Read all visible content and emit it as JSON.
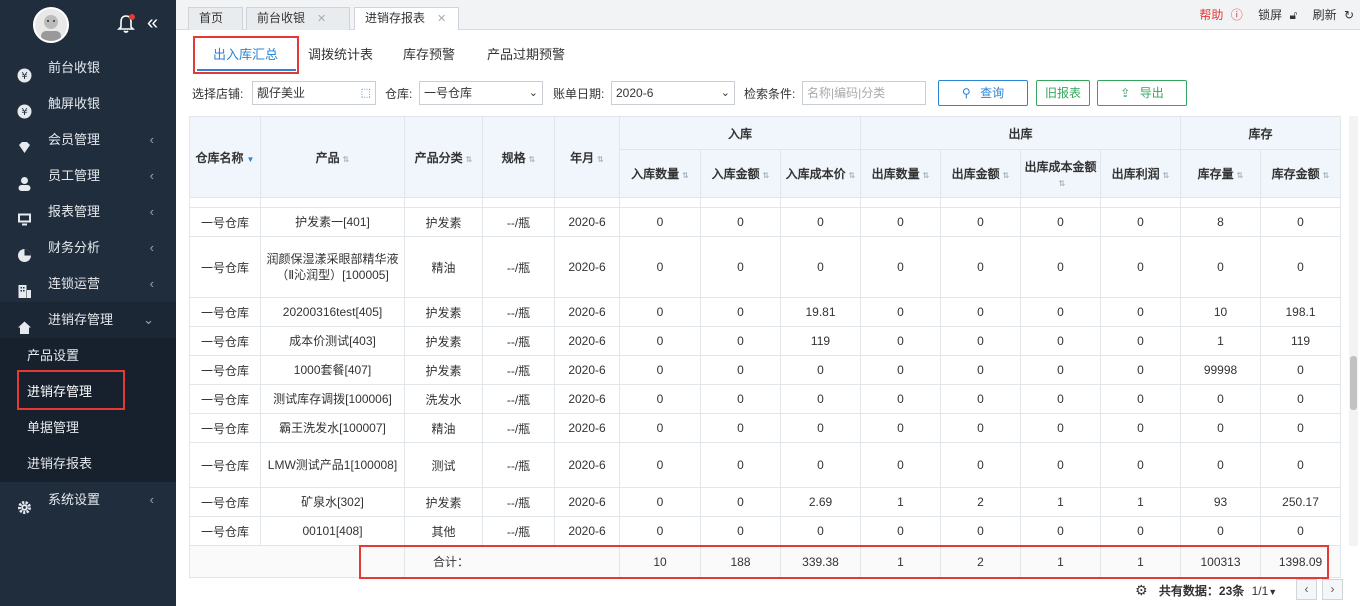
{
  "sidebar": {
    "menu": [
      {
        "label": "前台收银",
        "icon": "cash-icon",
        "arrow": ""
      },
      {
        "label": "触屏收银",
        "icon": "cash-icon",
        "arrow": ""
      },
      {
        "label": "会员管理",
        "icon": "diamond-icon",
        "arrow": "‹"
      },
      {
        "label": "员工管理",
        "icon": "user-icon",
        "arrow": "‹"
      },
      {
        "label": "报表管理",
        "icon": "monitor-icon",
        "arrow": "‹"
      },
      {
        "label": "财务分析",
        "icon": "pie-chart-icon",
        "arrow": "‹"
      },
      {
        "label": "连锁运营",
        "icon": "building-icon",
        "arrow": "‹"
      },
      {
        "label": "进销存管理",
        "icon": "home-icon",
        "arrow": "⌄"
      }
    ],
    "submenu": [
      "产品设置",
      "进销存管理",
      "单据管理",
      "进销存报表"
    ],
    "settings": {
      "label": "系统设置",
      "icon": "gear-icon",
      "arrow": "‹"
    }
  },
  "topbar": {
    "tabs": [
      {
        "label": "首页",
        "closable": false
      },
      {
        "label": "前台收银",
        "closable": true
      },
      {
        "label": "进销存报表",
        "closable": true
      }
    ],
    "help": "帮助",
    "lock": "锁屏",
    "refresh": "刷新"
  },
  "subtabs": [
    "出入库汇总",
    "调拨统计表",
    "库存预警",
    "产品过期预警"
  ],
  "filters": {
    "store_label": "选择店铺:",
    "store_value": "靓仔美业",
    "warehouse_label": "仓库:",
    "warehouse_value": "一号仓库",
    "date_label": "账单日期:",
    "date_value": "2020-6",
    "search_label": "检索条件:",
    "search_placeholder": "名称|编码|分类",
    "query_btn": "查询",
    "old_report_btn": "旧报表",
    "export_btn": "导出"
  },
  "table": {
    "group_headers": {
      "in": "入库",
      "out": "出库",
      "stock": "库存"
    },
    "headers": {
      "warehouse": "仓库名称",
      "product": "产品",
      "category": "产品分类",
      "spec": "规格",
      "month": "年月",
      "in_qty": "入库数量",
      "in_amount": "入库金额",
      "in_cost": "入库成本价",
      "out_qty": "出库数量",
      "out_amount": "出库金额",
      "out_cost": "出库成本金额",
      "out_profit": "出库利润",
      "stock_qty": "库存量",
      "stock_amount": "库存金额"
    },
    "rows": [
      [
        "一号仓库",
        "护发素一[401]",
        "护发素",
        "--/瓶",
        "2020-6",
        "0",
        "0",
        "0",
        "0",
        "0",
        "0",
        "0",
        "8",
        "0"
      ],
      [
        "一号仓库",
        "润颜保湿漾采眼部精华液（Ⅱ沁润型）[100005]",
        "精油",
        "--/瓶",
        "2020-6",
        "0",
        "0",
        "0",
        "0",
        "0",
        "0",
        "0",
        "0",
        "0"
      ],
      [
        "一号仓库",
        "20200316test[405]",
        "护发素",
        "--/瓶",
        "2020-6",
        "0",
        "0",
        "19.81",
        "0",
        "0",
        "0",
        "0",
        "10",
        "198.1"
      ],
      [
        "一号仓库",
        "成本价测试[403]",
        "护发素",
        "--/瓶",
        "2020-6",
        "0",
        "0",
        "119",
        "0",
        "0",
        "0",
        "0",
        "1",
        "119"
      ],
      [
        "一号仓库",
        "1000套餐[407]",
        "护发素",
        "--/瓶",
        "2020-6",
        "0",
        "0",
        "0",
        "0",
        "0",
        "0",
        "0",
        "99998",
        "0"
      ],
      [
        "一号仓库",
        "测试库存调拨[100006]",
        "洗发水",
        "--/瓶",
        "2020-6",
        "0",
        "0",
        "0",
        "0",
        "0",
        "0",
        "0",
        "0",
        "0"
      ],
      [
        "一号仓库",
        "霸王洗发水[100007]",
        "精油",
        "--/瓶",
        "2020-6",
        "0",
        "0",
        "0",
        "0",
        "0",
        "0",
        "0",
        "0",
        "0"
      ],
      [
        "一号仓库",
        "LMW测试产品1[100008]",
        "测试",
        "--/瓶",
        "2020-6",
        "0",
        "0",
        "0",
        "0",
        "0",
        "0",
        "0",
        "0",
        "0"
      ],
      [
        "一号仓库",
        "矿泉水[302]",
        "护发素",
        "--/瓶",
        "2020-6",
        "0",
        "0",
        "2.69",
        "1",
        "2",
        "1",
        "1",
        "93",
        "250.17"
      ],
      [
        "一号仓库",
        "00101[408]",
        "其他",
        "--/瓶",
        "2020-6",
        "0",
        "0",
        "0",
        "0",
        "0",
        "0",
        "0",
        "0",
        "0"
      ]
    ],
    "total_label": "合计：",
    "totals": [
      "10",
      "188",
      "339.38",
      "1",
      "2",
      "1",
      "1",
      "100313",
      "1398.09"
    ]
  },
  "footer": {
    "count_text": "共有数据：23条",
    "page": "1/1"
  },
  "colors": {
    "sidebar_bg": "#1f2d3d",
    "accent": "#2a86d5",
    "highlight": "#e53935",
    "green": "#33a55c"
  }
}
